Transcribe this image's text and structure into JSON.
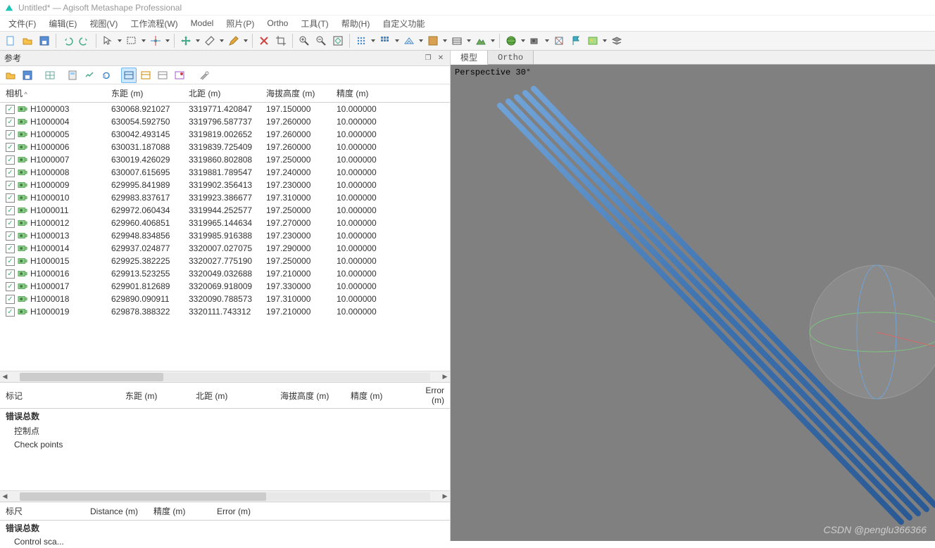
{
  "window": {
    "title": "Untitled* — Agisoft Metashape Professional"
  },
  "menu": [
    "文件(F)",
    "编辑(E)",
    "视图(V)",
    "工作流程(W)",
    "Model",
    "照片(P)",
    "Ortho",
    "工具(T)",
    "帮助(H)",
    "自定义功能"
  ],
  "panels": {
    "reference": {
      "title": "参考"
    },
    "tabs": {
      "model": "模型",
      "ortho": "Ortho"
    }
  },
  "viewport": {
    "label": "Perspective 30°",
    "watermark": "CSDN @penglu366366"
  },
  "cameras": {
    "headers": [
      "相机",
      "东距 (m)",
      "北距 (m)",
      "海拔高度 (m)",
      "精度 (m)"
    ],
    "rows": [
      {
        "name": "H1000003",
        "e": "630068.921027",
        "n": "3319771.420847",
        "alt": "197.150000",
        "acc": "10.000000"
      },
      {
        "name": "H1000004",
        "e": "630054.592750",
        "n": "3319796.587737",
        "alt": "197.260000",
        "acc": "10.000000"
      },
      {
        "name": "H1000005",
        "e": "630042.493145",
        "n": "3319819.002652",
        "alt": "197.260000",
        "acc": "10.000000"
      },
      {
        "name": "H1000006",
        "e": "630031.187088",
        "n": "3319839.725409",
        "alt": "197.260000",
        "acc": "10.000000"
      },
      {
        "name": "H1000007",
        "e": "630019.426029",
        "n": "3319860.802808",
        "alt": "197.250000",
        "acc": "10.000000"
      },
      {
        "name": "H1000008",
        "e": "630007.615695",
        "n": "3319881.789547",
        "alt": "197.240000",
        "acc": "10.000000"
      },
      {
        "name": "H1000009",
        "e": "629995.841989",
        "n": "3319902.356413",
        "alt": "197.230000",
        "acc": "10.000000"
      },
      {
        "name": "H1000010",
        "e": "629983.837617",
        "n": "3319923.386677",
        "alt": "197.310000",
        "acc": "10.000000"
      },
      {
        "name": "H1000011",
        "e": "629972.060434",
        "n": "3319944.252577",
        "alt": "197.250000",
        "acc": "10.000000"
      },
      {
        "name": "H1000012",
        "e": "629960.406851",
        "n": "3319965.144634",
        "alt": "197.270000",
        "acc": "10.000000"
      },
      {
        "name": "H1000013",
        "e": "629948.834856",
        "n": "3319985.916388",
        "alt": "197.230000",
        "acc": "10.000000"
      },
      {
        "name": "H1000014",
        "e": "629937.024877",
        "n": "3320007.027075",
        "alt": "197.290000",
        "acc": "10.000000"
      },
      {
        "name": "H1000015",
        "e": "629925.382225",
        "n": "3320027.775190",
        "alt": "197.250000",
        "acc": "10.000000"
      },
      {
        "name": "H1000016",
        "e": "629913.523255",
        "n": "3320049.032688",
        "alt": "197.210000",
        "acc": "10.000000"
      },
      {
        "name": "H1000017",
        "e": "629901.812689",
        "n": "3320069.918009",
        "alt": "197.330000",
        "acc": "10.000000"
      },
      {
        "name": "H1000018",
        "e": "629890.090911",
        "n": "3320090.788573",
        "alt": "197.310000",
        "acc": "10.000000"
      },
      {
        "name": "H1000019",
        "e": "629878.388322",
        "n": "3320111.743312",
        "alt": "197.210000",
        "acc": "10.000000"
      }
    ]
  },
  "markers": {
    "headers": [
      "标记",
      "东距 (m)",
      "北距 (m)",
      "海拔高度 (m)",
      "精度 (m)",
      "Error (m)"
    ],
    "total": "错误总数",
    "rows": [
      "控制点",
      "Check points"
    ]
  },
  "scale": {
    "headers": [
      "标尺",
      "Distance (m)",
      "精度 (m)",
      "Error (m)"
    ],
    "total": "错误总数",
    "rows": [
      "Control sca..."
    ]
  }
}
